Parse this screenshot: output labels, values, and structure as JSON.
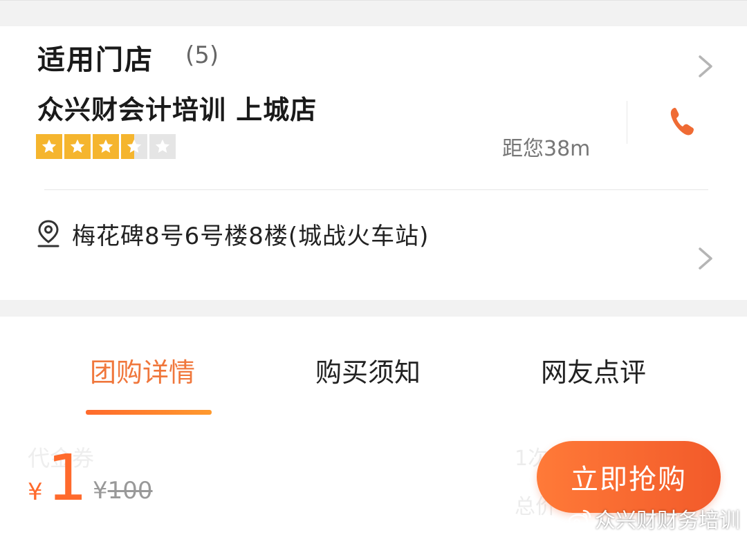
{
  "store_section": {
    "title": "适用门店",
    "count": "(5)",
    "store_name": "众兴财会计培训 上城店",
    "rating_stars": 3.5,
    "rating_max": 5,
    "distance": "距您38m",
    "address": "梅花碑8号6号楼8楼(城战火车站)"
  },
  "tabs": [
    {
      "label": "团购详情",
      "active": true
    },
    {
      "label": "购买须知",
      "active": false
    },
    {
      "label": "网友点评",
      "active": false
    }
  ],
  "purchase_bar": {
    "ghost_left": "代金券",
    "ghost_right_1": "1次",
    "ghost_right_2": "总价",
    "currency": "¥",
    "price": "1",
    "original_currency": "¥",
    "original_price": "100",
    "buy_label": "立即抢购"
  },
  "watermark": "众兴财财务培训",
  "colors": {
    "accent": "#f0773c",
    "star_gold": "#f5b52e",
    "star_empty": "#e5e5e5",
    "button": "#f25a2a"
  },
  "icons": [
    "chevron-right-icon",
    "star-icon",
    "phone-icon",
    "location-pin-icon",
    "weibo-icon"
  ]
}
